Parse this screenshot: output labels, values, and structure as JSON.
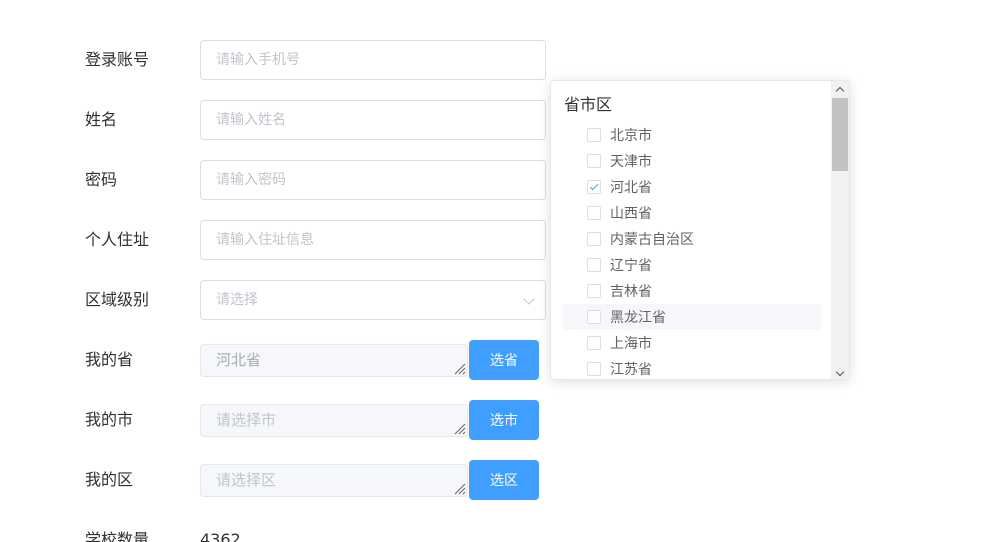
{
  "form": {
    "login_account": {
      "label": "登录账号",
      "placeholder": "请输入手机号"
    },
    "name": {
      "label": "姓名",
      "placeholder": "请输入姓名"
    },
    "password": {
      "label": "密码",
      "placeholder": "请输入密码"
    },
    "address": {
      "label": "个人住址",
      "placeholder": "请输入住址信息"
    },
    "region_level": {
      "label": "区域级别",
      "placeholder": "请选择"
    },
    "my_province": {
      "label": "我的省",
      "value": "河北省",
      "button": "选省"
    },
    "my_city": {
      "label": "我的市",
      "placeholder": "请选择市",
      "button": "选市"
    },
    "my_district": {
      "label": "我的区",
      "placeholder": "请选择区",
      "button": "选区"
    },
    "school_count": {
      "label": "学校数量",
      "value": "4362"
    }
  },
  "dropdown": {
    "header": "省市区",
    "options": [
      {
        "label": "北京市",
        "checked": false
      },
      {
        "label": "天津市",
        "checked": false
      },
      {
        "label": "河北省",
        "checked": true
      },
      {
        "label": "山西省",
        "checked": false
      },
      {
        "label": "内蒙古自治区",
        "checked": false
      },
      {
        "label": "辽宁省",
        "checked": false
      },
      {
        "label": "吉林省",
        "checked": false
      },
      {
        "label": "黑龙江省",
        "checked": false,
        "hover": true
      },
      {
        "label": "上海市",
        "checked": false
      },
      {
        "label": "江苏省",
        "checked": false
      }
    ]
  },
  "colors": {
    "primary": "#409eff",
    "border": "#dcdfe6",
    "placeholder": "#c0c4cc",
    "disabled_bg": "#f5f7fa"
  }
}
